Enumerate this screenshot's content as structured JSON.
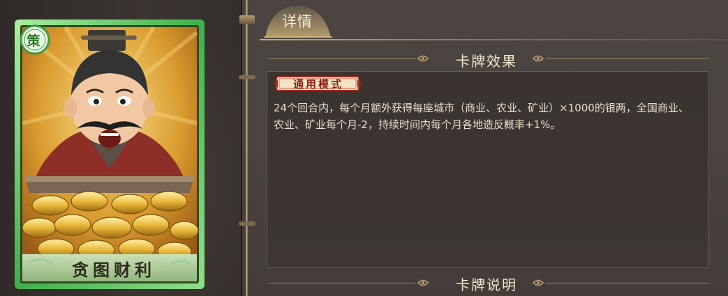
{
  "tabs": [
    {
      "label": "详情"
    }
  ],
  "card": {
    "name": "贪图财利",
    "seal": "策",
    "frame_color": "#5fd46a"
  },
  "sections": {
    "effect": {
      "title": "卡牌效果"
    },
    "description": {
      "title": "卡牌说明"
    }
  },
  "effect": {
    "mode_badge": "通用模式",
    "text": "24个回合内，每个月额外获得每座城市（商业、农业、矿业）×1000的银两，全国商业、农业、矿业每个月-2，持续时间内每个月各地造反概率+1%。"
  },
  "colors": {
    "panel_bg": "#4a4340",
    "accent_gold": "#c9ab70",
    "text_light": "#e9dfcf",
    "badge_text": "#8a1f14"
  }
}
